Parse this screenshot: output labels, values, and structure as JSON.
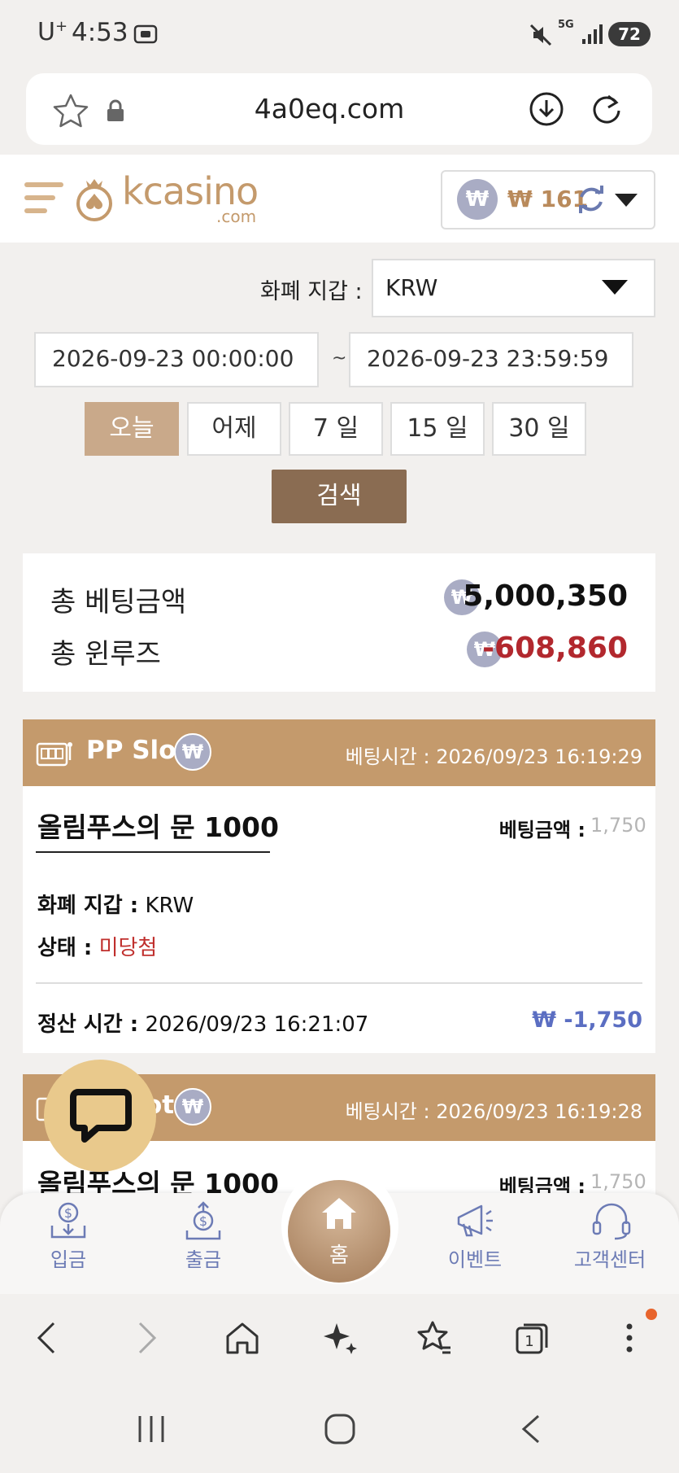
{
  "status_bar": {
    "carrier": "U",
    "carrier_sup": "+",
    "time": "4:53",
    "network": "5G",
    "battery": "72"
  },
  "browser": {
    "url": "4a0eq.com"
  },
  "header": {
    "logo_main": "kcasino",
    "logo_sub": ".com",
    "currency_symbol": "₩",
    "balance": "₩ 161"
  },
  "filters": {
    "currency_label": "화폐 지갑 :",
    "currency_value": "KRW",
    "date_start": "2026-09-23 00:00:00",
    "date_separator": "~",
    "date_end": "2026-09-23 23:59:59",
    "ranges": [
      "오늘",
      "어제",
      "7 일",
      "15 일",
      "30 일"
    ],
    "active_range": "오늘",
    "search_label": "검색"
  },
  "summary": {
    "total_bet_label": "총 베팅금액",
    "total_bet_value": "5,000,350",
    "total_winloss_label": "총 윈루즈",
    "total_winloss_value": "-608,860"
  },
  "bets": [
    {
      "provider": "PP Slot",
      "bet_time_label": "베팅시간 :",
      "bet_time": "2026/09/23 16:19:29",
      "game": "올림푸스의 문 1000",
      "amount_label": "베팅금액 :",
      "amount": "1,750",
      "wallet_label": "화폐 지갑 :",
      "wallet": "KRW",
      "status_label": "상태 :",
      "status": "미당첨",
      "settle_label": "정산 시간 :",
      "settle_time": "2026/09/23 16:21:07",
      "settle_amount": "₩ -1,750"
    },
    {
      "provider": "PP Slot",
      "provider_visible": "ot",
      "bet_time_label": "베팅시간 :",
      "bet_time": "2026/09/23 16:19:28",
      "game": "올림푸스의 문 1000",
      "amount_label": "베팅금액 :",
      "amount": "1,750"
    }
  ],
  "bottom_nav": {
    "deposit": "입금",
    "withdraw": "출금",
    "home": "홈",
    "event": "이벤트",
    "support": "고객센터"
  },
  "colors": {
    "accent": "#c49a6c",
    "search_button": "#8a6c52",
    "negative": "#b2282e",
    "settle_blue": "#5b6ec2",
    "coin": "#a9acc4"
  }
}
